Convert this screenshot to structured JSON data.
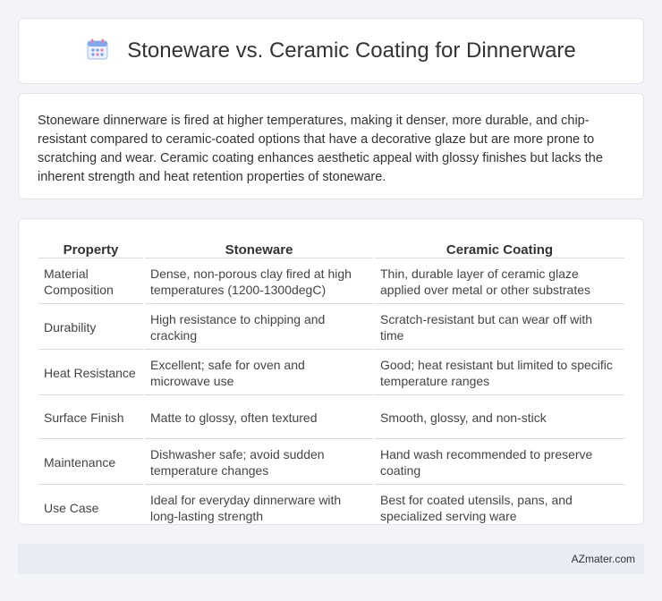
{
  "header": {
    "icon": "calendar-icon",
    "title": "Stoneware vs. Ceramic Coating for Dinnerware"
  },
  "intro": {
    "text": "Stoneware dinnerware is fired at higher temperatures, making it denser, more durable, and chip-resistant compared to ceramic-coated options that have a decorative glaze but are more prone to scratching and wear. Ceramic coating enhances aesthetic appeal with glossy finishes but lacks the inherent strength and heat retention properties of stoneware."
  },
  "table": {
    "headers": [
      "Property",
      "Stoneware",
      "Ceramic Coating"
    ],
    "rows": [
      [
        "Material Composition",
        "Dense, non-porous clay fired at high temperatures (1200-1300degC)",
        "Thin, durable layer of ceramic glaze applied over metal or other substrates"
      ],
      [
        "Durability",
        "High resistance to chipping and cracking",
        "Scratch-resistant but can wear off with time"
      ],
      [
        "Heat Resistance",
        "Excellent; safe for oven and microwave use",
        "Good; heat resistant but limited to specific temperature ranges"
      ],
      [
        "Surface Finish",
        "Matte to glossy, often textured",
        "Smooth, glossy, and non-stick"
      ],
      [
        "Maintenance",
        "Dishwasher safe; avoid sudden temperature changes",
        "Hand wash recommended to preserve coating"
      ],
      [
        "Use Case",
        "Ideal for everyday dinnerware with long-lasting strength",
        "Best for coated utensils, pans, and specialized serving ware"
      ]
    ]
  },
  "footer": {
    "brand": "AZmater.com"
  },
  "colors": {
    "background": "#f3f4f8",
    "footer_bg": "#e8ecf5",
    "icon_blue": "#6f9fe6",
    "icon_pink": "#e57fa6"
  }
}
